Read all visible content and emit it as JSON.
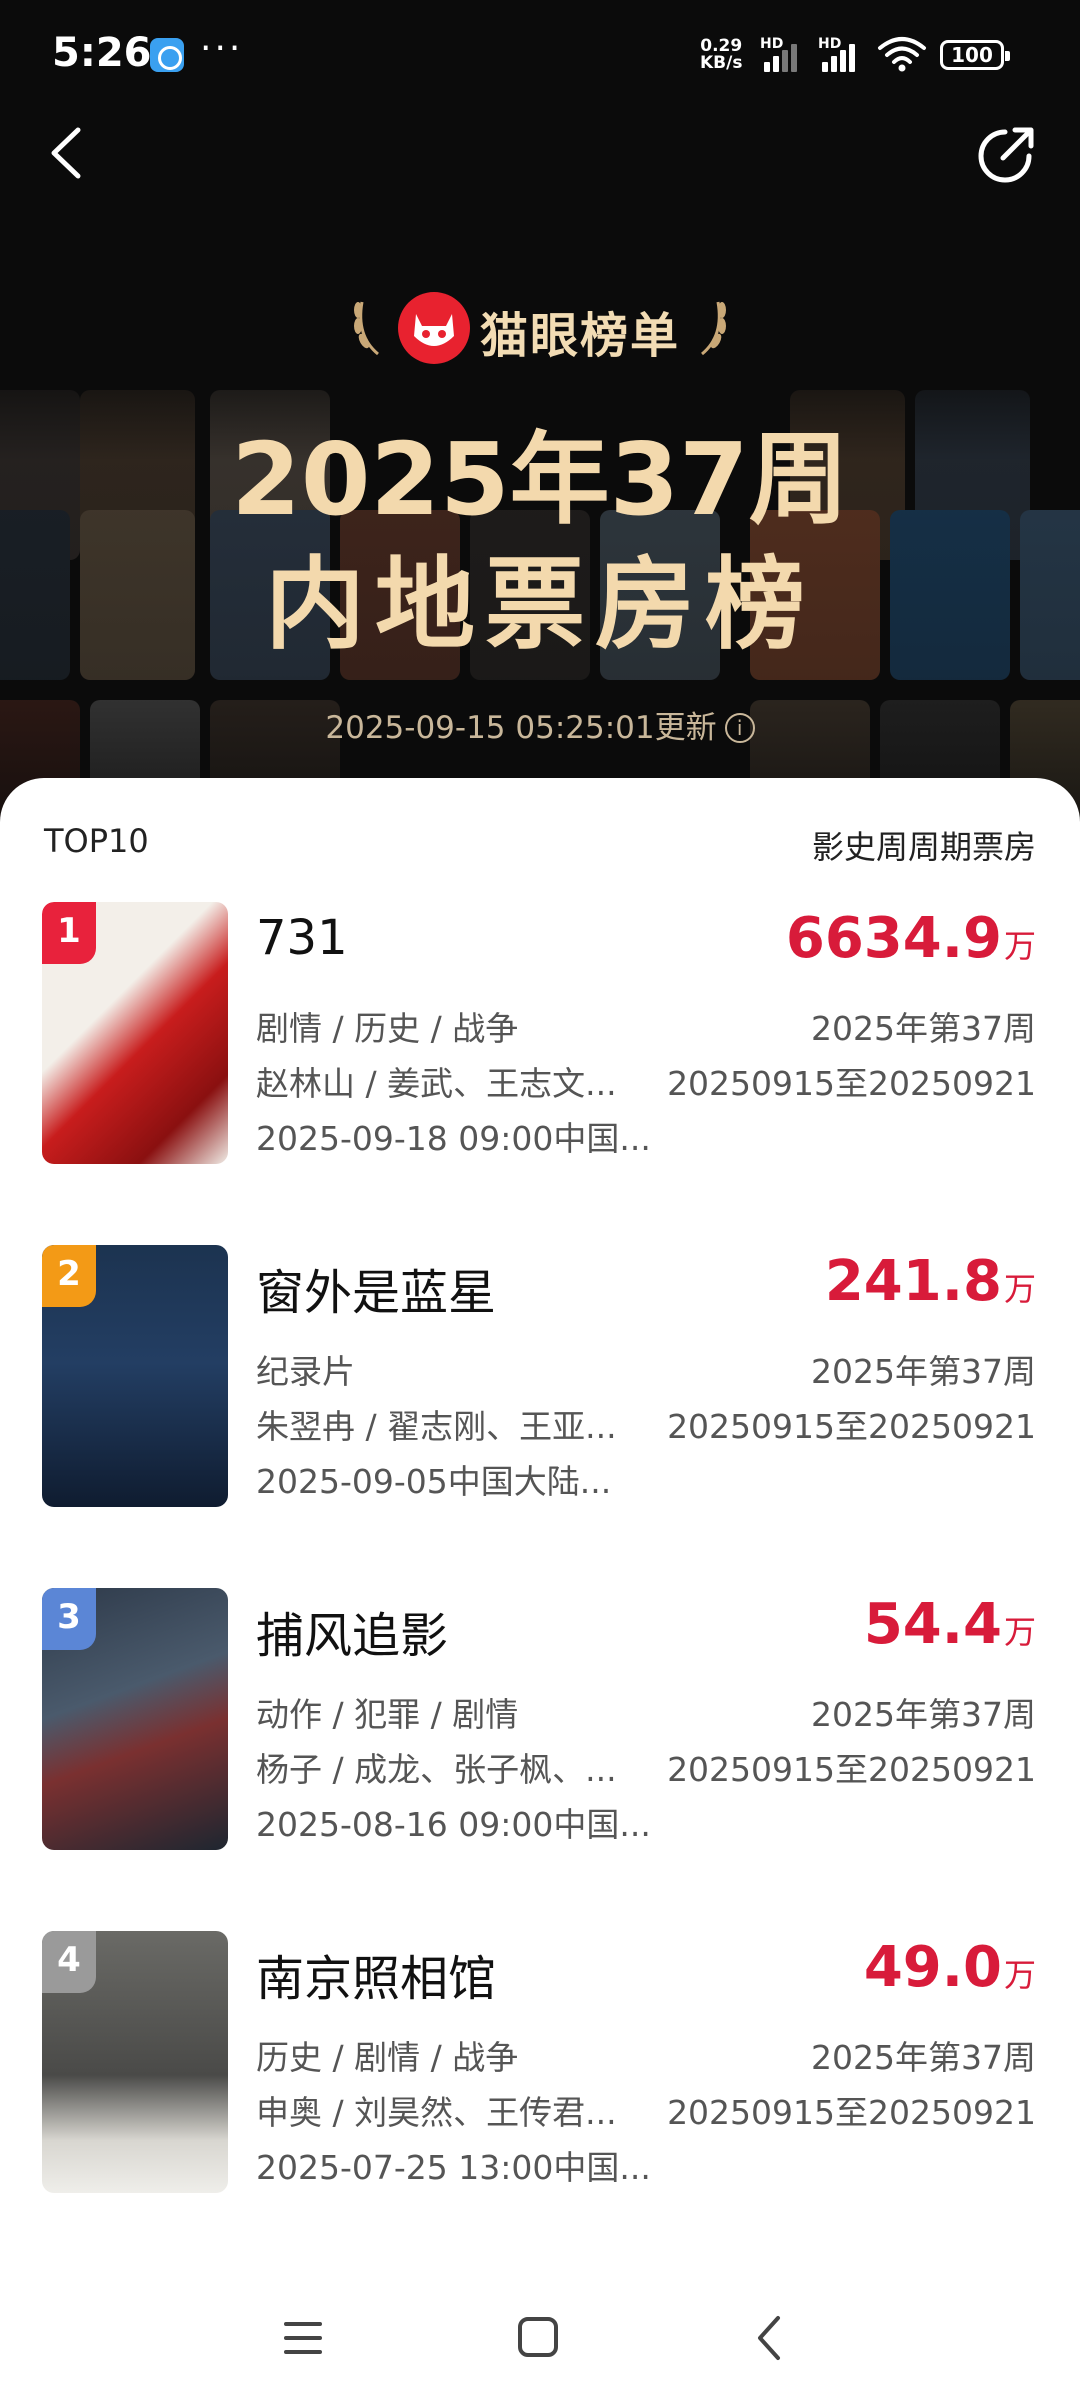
{
  "status_bar": {
    "time": "5:26",
    "more_dots": "···",
    "net_speed_value": "0.29",
    "net_speed_unit": "KB/s",
    "signal_1_label": "HD",
    "signal_2_label": "HD",
    "battery": "100"
  },
  "header": {
    "brand": "猫眼榜单",
    "title_line1": "2025年37周",
    "title_line2": "内地票房榜",
    "update_time": "2025-09-15 05:25:01更新",
    "info_glyph": "i"
  },
  "list": {
    "header_left": "TOP10",
    "header_right": "影史周周期票房",
    "items": [
      {
        "rank": "1",
        "name": "731",
        "box_office": "6634.9",
        "unit": "万",
        "genres": "剧情 / 历史 / 战争",
        "people": "赵林山 / 姜武、王志文...",
        "release": "2025-09-18 09:00中国...",
        "week": "2025年第37周",
        "period": "20250915至20250921",
        "rank_color": "#e8223c"
      },
      {
        "rank": "2",
        "name": "窗外是蓝星",
        "box_office": "241.8",
        "unit": "万",
        "genres": "纪录片",
        "people": "朱翌冉 / 翟志刚、王亚...",
        "release": "2025-09-05中国大陆...",
        "week": "2025年第37周",
        "period": "20250915至20250921",
        "rank_color": "#f39a16"
      },
      {
        "rank": "3",
        "name": "捕风追影",
        "box_office": "54.4",
        "unit": "万",
        "genres": "动作 / 犯罪 / 剧情",
        "people": "杨子 / 成龙、张子枫、...",
        "release": "2025-08-16 09:00中国...",
        "week": "2025年第37周",
        "period": "20250915至20250921",
        "rank_color": "#5b86d6"
      },
      {
        "rank": "4",
        "name": "南京照相馆",
        "box_office": "49.0",
        "unit": "万",
        "genres": "历史 / 剧情 / 战争",
        "people": "申奥 / 刘昊然、王传君...",
        "release": "2025-07-25 13:00中国...",
        "week": "2025年第37周",
        "period": "20250915至20250921",
        "rank_color": "#9a9a9a"
      }
    ]
  },
  "colors": {
    "accent_red": "#d81b3a",
    "title_gold": "#f3d9ad",
    "logo_red": "#e8222f"
  }
}
